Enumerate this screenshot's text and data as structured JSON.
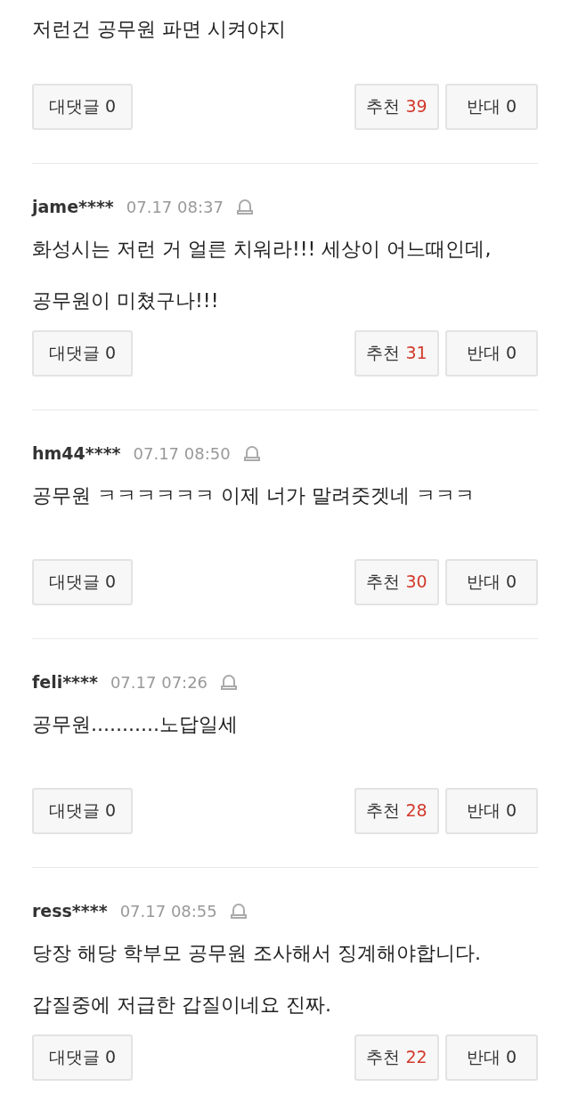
{
  "comments": [
    {
      "text": "저런건 공무원 파면 시켜야지",
      "reply_label": "대댓글",
      "replies": "0",
      "up_label": "추천",
      "up": "39",
      "down_label": "반대",
      "down": "0"
    },
    {
      "user": "jame****",
      "time": "07.17 08:37",
      "text": "화성시는 저런 거 얼른 치워라!!! 세상이 어느때인데, 공무원이 미쳤구나!!!",
      "reply_label": "대댓글",
      "replies": "0",
      "up_label": "추천",
      "up": "31",
      "down_label": "반대",
      "down": "0"
    },
    {
      "user": "hm44****",
      "time": "07.17 08:50",
      "text": "공무원 ㅋㅋㅋㅋㅋㅋ 이제 너가 말려줏겟네 ㅋㅋㅋ",
      "reply_label": "대댓글",
      "replies": "0",
      "up_label": "추천",
      "up": "30",
      "down_label": "반대",
      "down": "0"
    },
    {
      "user": "feli****",
      "time": "07.17 07:26",
      "text": "공무원...........노답일세",
      "reply_label": "대댓글",
      "replies": "0",
      "up_label": "추천",
      "up": "28",
      "down_label": "반대",
      "down": "0"
    },
    {
      "user": "ress****",
      "time": "07.17 08:55",
      "text": "당장 해당 학부모 공무원 조사해서 징계해야합니다. 갑질중에 저급한 갑질이네요 진짜.",
      "reply_label": "대댓글",
      "replies": "0",
      "up_label": "추천",
      "up": "22",
      "down_label": "반대",
      "down": "0"
    }
  ]
}
